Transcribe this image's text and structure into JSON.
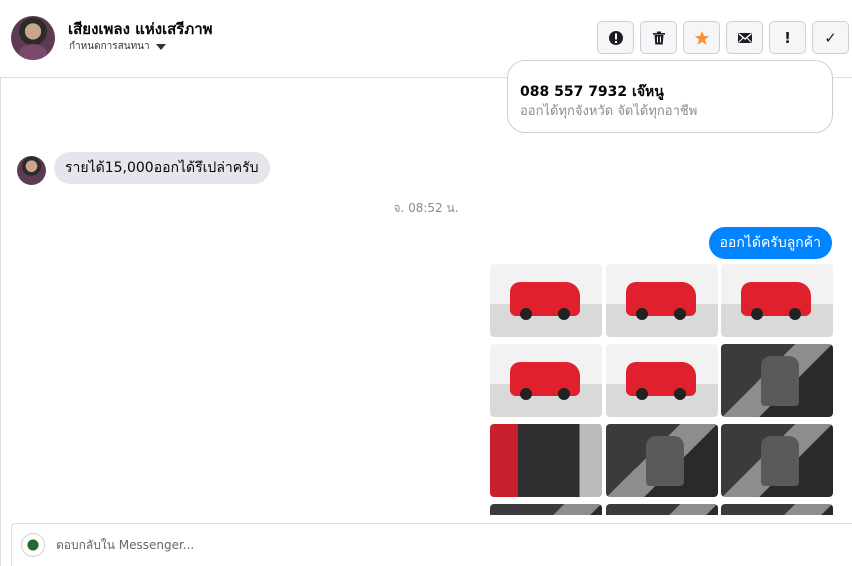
{
  "header": {
    "contact_name": "เสียงเพลง แห่งเสรีภาพ",
    "conversation_label": "กำหนดการสนทนา"
  },
  "actions": [
    {
      "name": "report-button",
      "icon": "exclamation-circle-icon"
    },
    {
      "name": "delete-button",
      "icon": "trash-icon"
    },
    {
      "name": "star-button",
      "icon": "star-icon",
      "color": "#f7923a"
    },
    {
      "name": "mail-button",
      "icon": "envelope-icon"
    },
    {
      "name": "spam-button",
      "icon": "exclamation-icon",
      "label": "!"
    },
    {
      "name": "done-button",
      "icon": "check-icon",
      "label": "✓"
    }
  ],
  "messages": {
    "card_phone": "088 557 7932 เจ๊หนู",
    "card_line2": "ออกได้ทุกจังหวัด จัดได้ทุกอาชีพ",
    "incoming_text": "รายได้15,000ออกได้รึเปล่าครับ",
    "timestamp": "จ. 08:52 น.",
    "outgoing_text": "ออกได้ครับลูกค้า"
  },
  "photos": [
    {
      "kind": "truck-rear"
    },
    {
      "kind": "truck-front"
    },
    {
      "kind": "truck-side"
    },
    {
      "kind": "truck-rear"
    },
    {
      "kind": "truck-side"
    },
    {
      "kind": "interior"
    },
    {
      "kind": "door"
    },
    {
      "kind": "interior"
    },
    {
      "kind": "interior"
    },
    {
      "kind": "interior"
    },
    {
      "kind": "interior"
    },
    {
      "kind": "interior"
    }
  ],
  "reply": {
    "placeholder": "ตอบกลับใน Messenger..."
  },
  "colors": {
    "accent_blue": "#0084ff",
    "incoming_bubble": "#e4e6eb",
    "star_orange": "#f7923a"
  }
}
